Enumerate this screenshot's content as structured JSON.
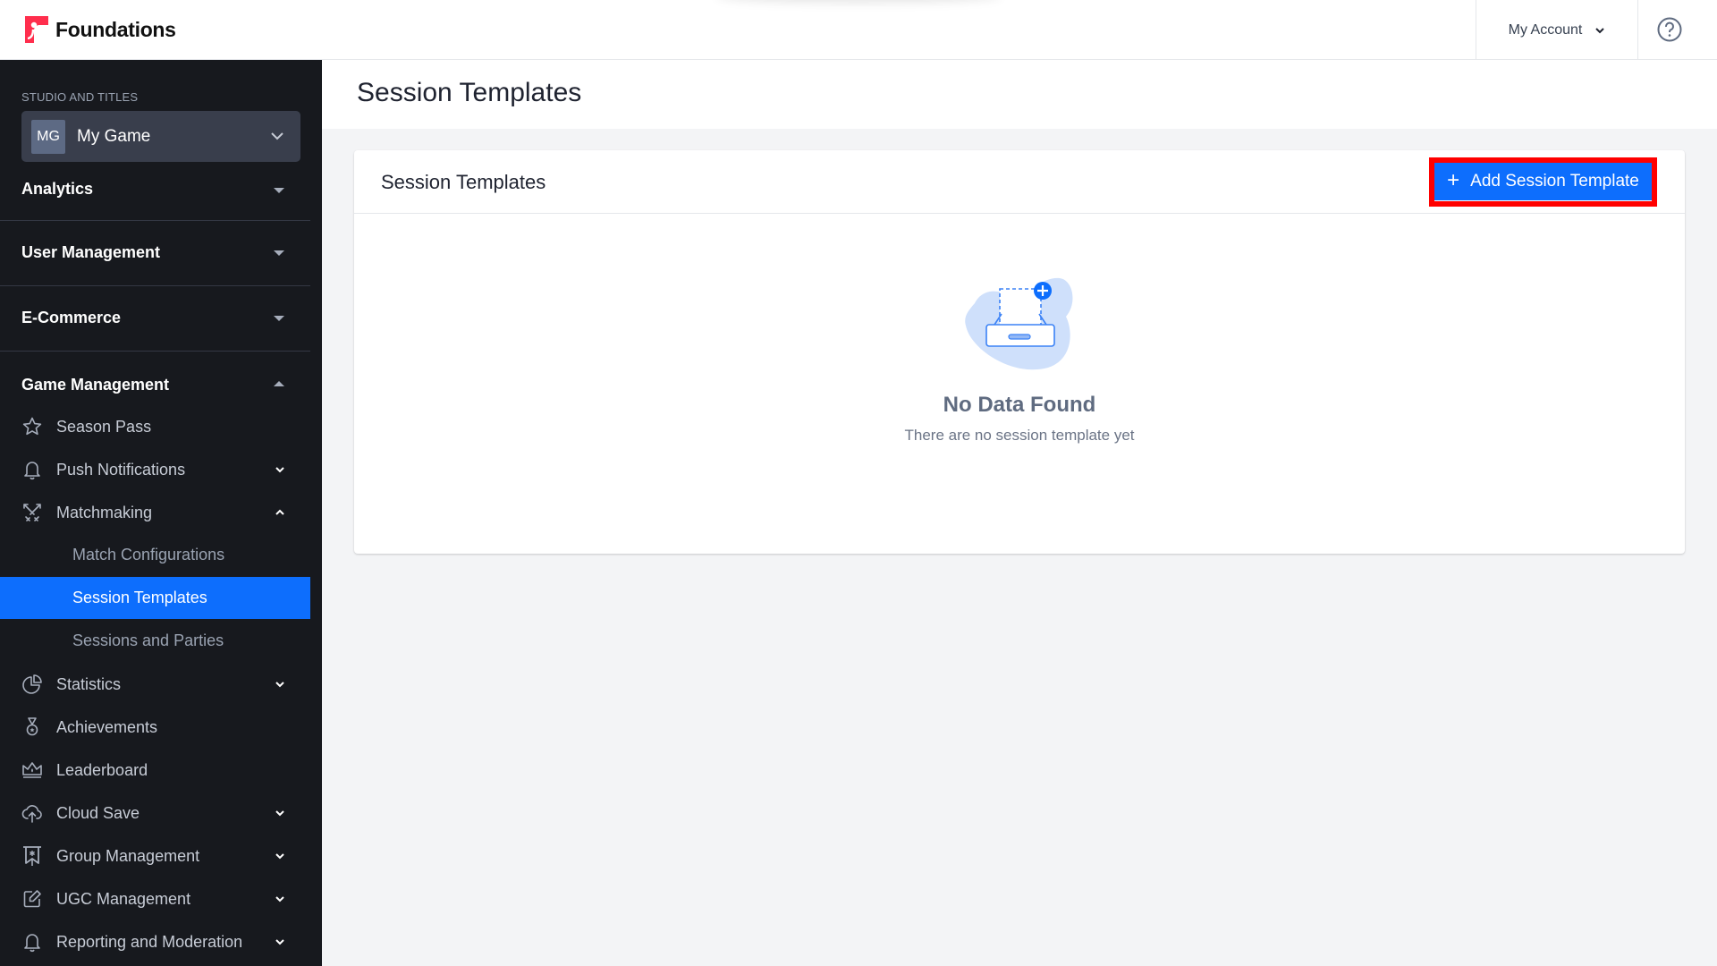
{
  "app": {
    "brand_name": "Foundations",
    "brand_color": "#ff2e4d",
    "accent_color": "#0d6efd",
    "account_label": "My Account",
    "help_icon": "question-circle-icon"
  },
  "sidebar": {
    "studio_label": "STUDIO AND TITLES",
    "studio": {
      "initials": "MG",
      "name": "My Game"
    },
    "sections": [
      {
        "label": "Analytics",
        "state": "collapsed"
      },
      {
        "label": "User Management",
        "state": "collapsed"
      },
      {
        "label": "E-Commerce",
        "state": "collapsed"
      },
      {
        "label": "Game Management",
        "state": "expanded"
      }
    ],
    "items": [
      {
        "label": "Season Pass",
        "icon": "star-icon",
        "has_children": false
      },
      {
        "label": "Push Notifications",
        "icon": "bell-icon",
        "has_children": true,
        "expanded": false
      },
      {
        "label": "Matchmaking",
        "icon": "crossed-swords-icon",
        "has_children": true,
        "expanded": true,
        "children": [
          {
            "label": "Match Configurations",
            "active": false
          },
          {
            "label": "Session Templates",
            "active": true
          },
          {
            "label": "Sessions and Parties",
            "active": false
          }
        ]
      },
      {
        "label": "Statistics",
        "icon": "pie-chart-icon",
        "has_children": true,
        "expanded": false
      },
      {
        "label": "Achievements",
        "icon": "medal-icon",
        "has_children": false
      },
      {
        "label": "Leaderboard",
        "icon": "crown-icon",
        "has_children": false
      },
      {
        "label": "Cloud Save",
        "icon": "cloud-upload-icon",
        "has_children": true,
        "expanded": false
      },
      {
        "label": "Group Management",
        "icon": "banner-icon",
        "has_children": true,
        "expanded": false
      },
      {
        "label": "UGC Management",
        "icon": "edit-icon",
        "has_children": true,
        "expanded": false
      },
      {
        "label": "Reporting and Moderation",
        "icon": "bell-icon",
        "has_children": true,
        "expanded": false
      }
    ]
  },
  "main": {
    "page_title": "Session Templates",
    "card": {
      "title": "Session Templates",
      "add_button_label": "Add Session Template",
      "add_button_icon": "plus-icon",
      "empty_state": {
        "icon": "empty-inbox-icon",
        "title": "No Data Found",
        "subtitle": "There are no session template yet"
      }
    }
  }
}
